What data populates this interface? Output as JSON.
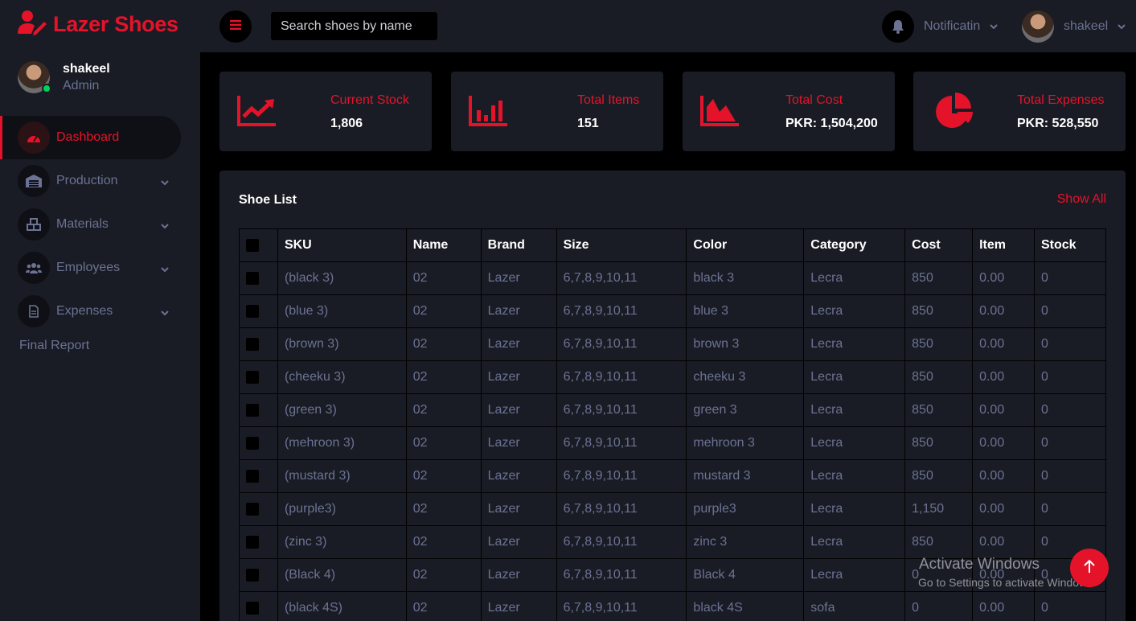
{
  "brand": {
    "title": "Lazer Shoes"
  },
  "profile": {
    "name": "shakeel",
    "role": "Admin"
  },
  "sidebar": {
    "items": [
      {
        "label": "Dashboard",
        "icon": "speedometer-icon",
        "active": true
      },
      {
        "label": "Production",
        "icon": "warehouse-icon"
      },
      {
        "label": "Materials",
        "icon": "cubes-icon"
      },
      {
        "label": "Employees",
        "icon": "users-icon"
      },
      {
        "label": "Expenses",
        "icon": "file-icon"
      }
    ],
    "final_report": "Final Report"
  },
  "topbar": {
    "search_placeholder": "Search shoes by name",
    "notification_label": "Notificatin",
    "user_name": "shakeel"
  },
  "cards": [
    {
      "label": "Current Stock",
      "value": "1,806",
      "icon": "trend-chart-icon"
    },
    {
      "label": "Total Items",
      "value": "151",
      "icon": "bar-chart-icon"
    },
    {
      "label": "Total Cost",
      "value": "PKR: 1,504,200",
      "icon": "area-chart-icon"
    },
    {
      "label": "Total Expenses",
      "value": "PKR: 528,550",
      "icon": "pie-chart-icon"
    }
  ],
  "shoe_list": {
    "title": "Shoe List",
    "show_all": "Show All",
    "columns": [
      "SKU",
      "Name",
      "Brand",
      "Size",
      "Color",
      "Category",
      "Cost",
      "Item",
      "Stock"
    ],
    "rows": [
      [
        "(black 3)",
        "02",
        "Lazer",
        "6,7,8,9,10,11",
        "black 3",
        "Lecra",
        "850",
        "0.00",
        "0"
      ],
      [
        "(blue 3)",
        "02",
        "Lazer",
        "6,7,8,9,10,11",
        "blue 3",
        "Lecra",
        "850",
        "0.00",
        "0"
      ],
      [
        "(brown 3)",
        "02",
        "Lazer",
        "6,7,8,9,10,11",
        "brown 3",
        "Lecra",
        "850",
        "0.00",
        "0"
      ],
      [
        "(cheeku 3)",
        "02",
        "Lazer",
        "6,7,8,9,10,11",
        "cheeku 3",
        "Lecra",
        "850",
        "0.00",
        "0"
      ],
      [
        "(green 3)",
        "02",
        "Lazer",
        "6,7,8,9,10,11",
        "green 3",
        "Lecra",
        "850",
        "0.00",
        "0"
      ],
      [
        "(mehroon 3)",
        "02",
        "Lazer",
        "6,7,8,9,10,11",
        "mehroon 3",
        "Lecra",
        "850",
        "0.00",
        "0"
      ],
      [
        "(mustard 3)",
        "02",
        "Lazer",
        "6,7,8,9,10,11",
        "mustard 3",
        "Lecra",
        "850",
        "0.00",
        "0"
      ],
      [
        "(purple3)",
        "02",
        "Lazer",
        "6,7,8,9,10,11",
        "purple3",
        "Lecra",
        "1,150",
        "0.00",
        "0"
      ],
      [
        "(zinc 3)",
        "02",
        "Lazer",
        "6,7,8,9,10,11",
        "zinc 3",
        "Lecra",
        "850",
        "0.00",
        "0"
      ],
      [
        "(Black 4)",
        "02",
        "Lazer",
        "6,7,8,9,10,11",
        "Black 4",
        "Lecra",
        "0",
        "0.00",
        "0"
      ],
      [
        "(black 4S)",
        "02",
        "Lazer",
        "6,7,8,9,10,11",
        "black 4S",
        "sofa",
        "0",
        "0.00",
        "0"
      ]
    ]
  },
  "watermark": {
    "line1": "Activate Windows",
    "line2": "Go to Settings to activate Windows."
  },
  "colors": {
    "accent": "#e5132a",
    "panel": "#191c24",
    "muted": "#6c7293",
    "background": "#000000"
  }
}
